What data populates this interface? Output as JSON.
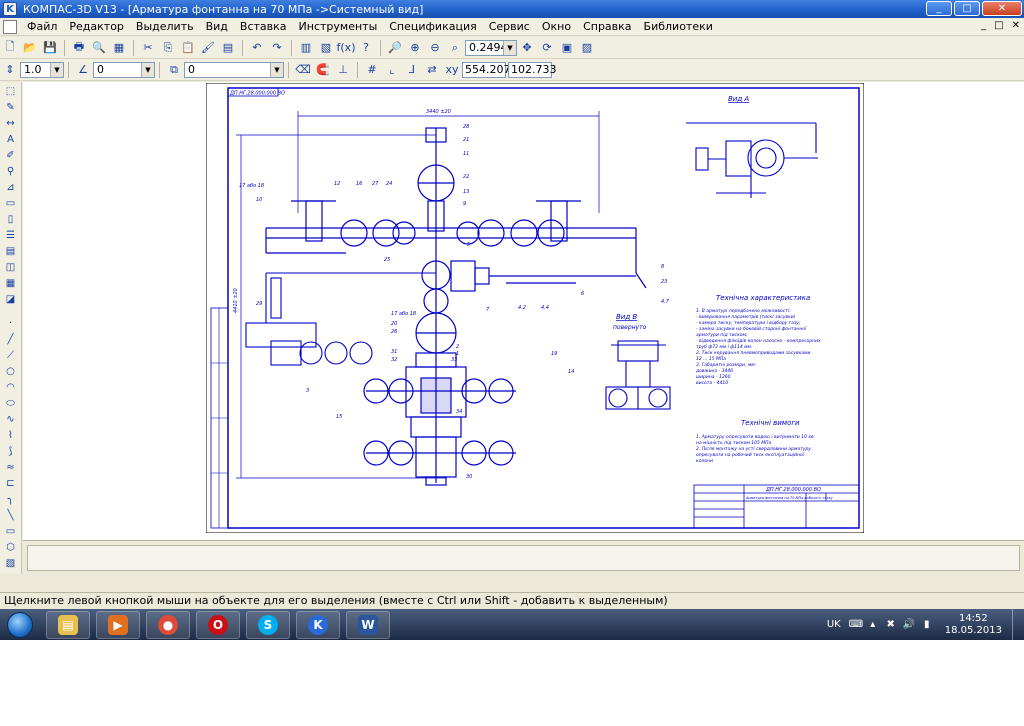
{
  "window": {
    "title": "КОМПАС-3D V13 - [Арматура фонтанна на 70 МПа ->Системный вид]",
    "controls": {
      "minimize": "_",
      "maximize": "□",
      "close": "✕"
    }
  },
  "menu": {
    "items": [
      "Файл",
      "Редактор",
      "Выделить",
      "Вид",
      "Вставка",
      "Инструменты",
      "Спецификация",
      "Сервис",
      "Окно",
      "Справка",
      "Библиотеки"
    ],
    "mdi_controls": [
      "_",
      "□",
      "✕"
    ]
  },
  "toolbar1": {
    "zoom_value": "0.2494"
  },
  "toolbar2": {
    "step_value": "1.0",
    "angle_value": "0",
    "layer_value": "0",
    "coord_x": "554.207",
    "coord_y": "102.733"
  },
  "drawing": {
    "stamp_code": "ДП.НГ.28.000.000 ВО",
    "view_a_label": "Вид А",
    "view_b_label": "Вид В",
    "view_b_sub": "повернуто",
    "tech_char_title": "Технічна характеристика",
    "tech_char_lines": [
      "1. В арматурі передбачено можливості:",
      " - вимірювання параметрів (тиск/ засувки)",
      " - камера тиску, температури і відбору газу;",
      " - заміна засувки на боковій стороні фонтанної",
      "   арматури під тиском;",
      " - відведення флюїдів колон насосно - компресорних",
      "   труб ф73 мм і ф114 мм.",
      "2. Тиск керування пневмоприводами засувками",
      "   12 ... 15 МПа",
      "3. Габаритні розміри, мм:",
      "       довжина - 3440",
      "       ширина - 1260",
      "       висота - 4410"
    ],
    "tech_req_title": "Технічні вимоги",
    "tech_req_lines": [
      "1. Арматуру опресувати водою і витримати 10 хв",
      "   на міцність під тиском 105 МПа",
      "2. Після монтажу на усті свердловини арматуру",
      "   опресувати на робочий тиск експлуатаційної",
      "   колони"
    ],
    "titleblock_code": "ДП.НГ.28.000.000 ВО",
    "titleblock_name": "Арматура фонтанна на 70 МПа робочого тиску",
    "dimension_top": "3440 ±20",
    "dimension_left": "4410 ±20",
    "callouts": [
      "28",
      "21",
      "11",
      "17 або 18",
      "12",
      "16",
      "27",
      "24",
      "22",
      "13",
      "9",
      "10",
      "25",
      "5",
      "8",
      "7",
      "6",
      "4.7",
      "4.2",
      "4.4",
      "23",
      "19",
      "20",
      "26",
      "30",
      "31",
      "32",
      "33",
      "34",
      "14",
      "15",
      "29",
      "17 або 18",
      "3",
      "2",
      "1"
    ]
  },
  "status": {
    "message": "Щелкните левой кнопкой мыши на объекте для его выделения (вместе с Ctrl или Shift - добавить к выделенным)"
  },
  "taskbar": {
    "apps": [
      "explorer",
      "media-player",
      "chrome",
      "opera",
      "skype",
      "kompas",
      "word"
    ],
    "lang": "UK",
    "time": "14:52",
    "date": "18.05.2013"
  }
}
